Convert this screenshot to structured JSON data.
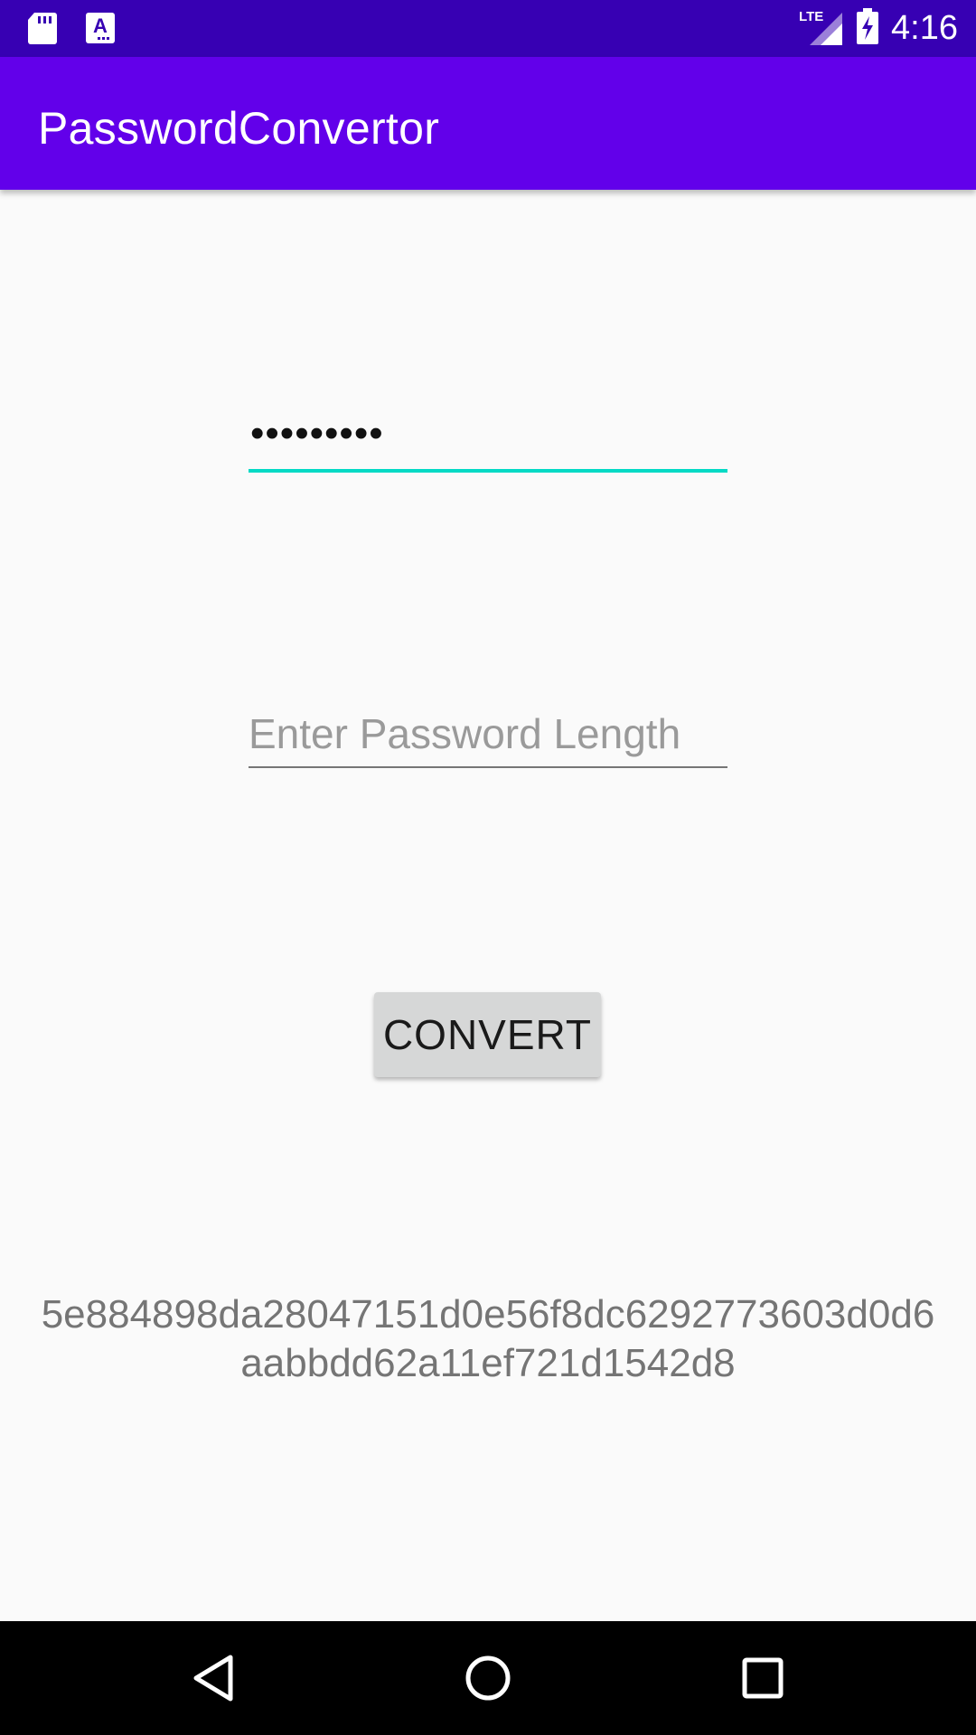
{
  "status_bar": {
    "time": "4:16",
    "network_label": "LTE",
    "icons": [
      "sd-card-icon",
      "text-a-icon",
      "lte-signal-icon",
      "battery-charging-icon"
    ]
  },
  "app_bar": {
    "title": "PasswordConvertor"
  },
  "password_input": {
    "value": "•••••••••"
  },
  "length_input": {
    "placeholder": "Enter Password Length",
    "value": ""
  },
  "convert_button": {
    "label": "CONVERT"
  },
  "result": {
    "text": "5e884898da28047151d0e56f8dc6292773603d0d6aabbdd62a11ef721d1542d8"
  },
  "nav_bar": {
    "icons": [
      "back-icon",
      "home-icon",
      "recents-icon"
    ]
  },
  "colors": {
    "status_bar": "#3700b3",
    "app_bar": "#6200ea",
    "accent": "#03dac5",
    "background": "#fafafa",
    "button": "#d6d7d7"
  }
}
